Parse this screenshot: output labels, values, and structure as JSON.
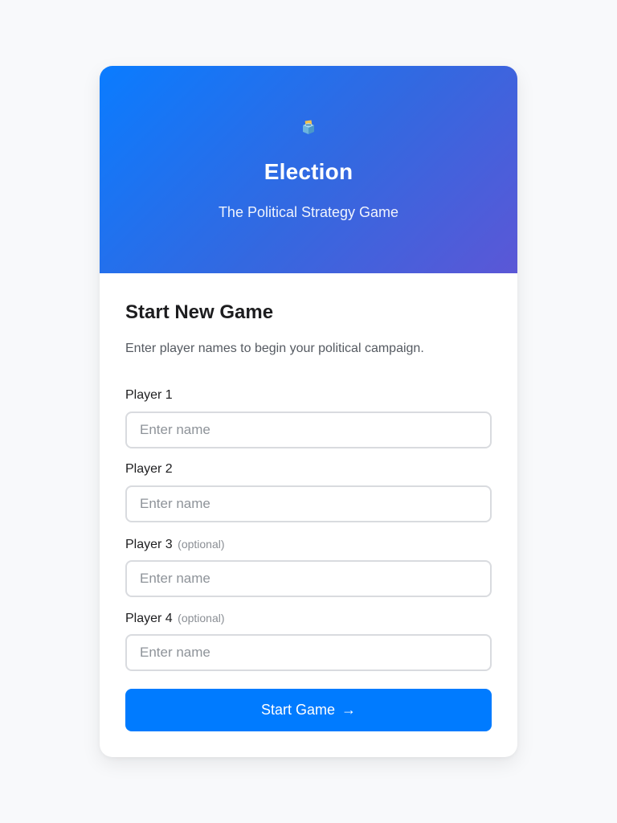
{
  "hero": {
    "icon": "ballot-box-icon",
    "title": "Election",
    "subtitle": "The Political Strategy Game"
  },
  "form": {
    "title": "Start New Game",
    "description": "Enter player names to begin your political campaign.",
    "players": [
      {
        "label": "Player 1",
        "optional": "",
        "placeholder": "Enter name",
        "value": ""
      },
      {
        "label": "Player 2",
        "optional": "",
        "placeholder": "Enter name",
        "value": ""
      },
      {
        "label": "Player 3",
        "optional": "(optional)",
        "placeholder": "Enter name",
        "value": ""
      },
      {
        "label": "Player 4",
        "optional": "(optional)",
        "placeholder": "Enter name",
        "value": ""
      }
    ],
    "submit_label": "Start Game",
    "submit_arrow": "→"
  },
  "colors": {
    "accent": "#007bff",
    "gradient_start": "#0a7cff",
    "gradient_end": "#5b57d6",
    "background": "#f8f9fb"
  }
}
